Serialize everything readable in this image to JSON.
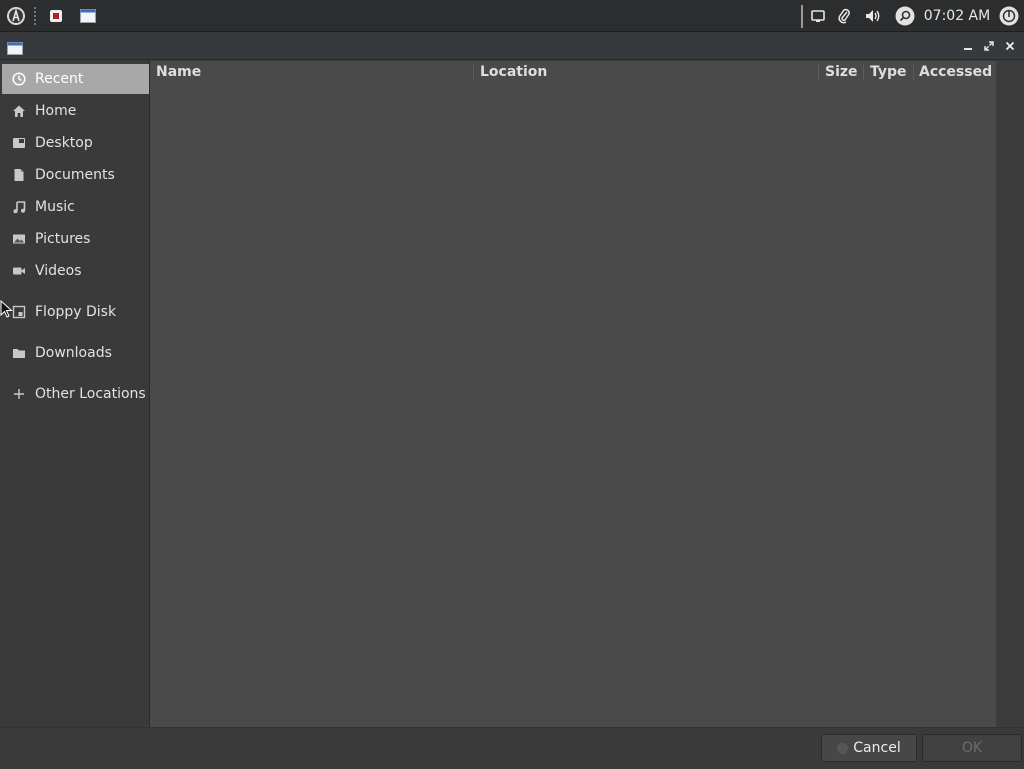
{
  "panel": {
    "clock": "07:02 AM",
    "icons": {
      "menu": "distro-logo-icon",
      "app1": "record-app-icon",
      "app2": "window-app-icon",
      "screen": "display-icon",
      "clip": "paperclip-icon",
      "volume": "volume-icon",
      "search": "search-icon",
      "power": "power-icon"
    }
  },
  "window": {
    "title": "",
    "controls": [
      "minimize",
      "maximize",
      "close"
    ]
  },
  "sidebar": {
    "items": [
      {
        "label": "Recent",
        "icon": "clock-icon",
        "active": true
      },
      {
        "label": "Home",
        "icon": "home-icon"
      },
      {
        "label": "Desktop",
        "icon": "desktop-icon"
      },
      {
        "label": "Documents",
        "icon": "document-icon"
      },
      {
        "label": "Music",
        "icon": "music-icon"
      },
      {
        "label": "Pictures",
        "icon": "picture-icon"
      },
      {
        "label": "Videos",
        "icon": "video-icon"
      },
      {
        "label": "Floppy Disk",
        "icon": "floppy-icon"
      },
      {
        "label": "Downloads",
        "icon": "folder-icon"
      },
      {
        "label": "Other Locations",
        "icon": "plus-icon"
      }
    ]
  },
  "filelist": {
    "columns": [
      "Name",
      "Location",
      "Size",
      "Type",
      "Accessed"
    ],
    "rows": []
  },
  "actions": {
    "cancel": "Cancel",
    "ok": "OK"
  }
}
